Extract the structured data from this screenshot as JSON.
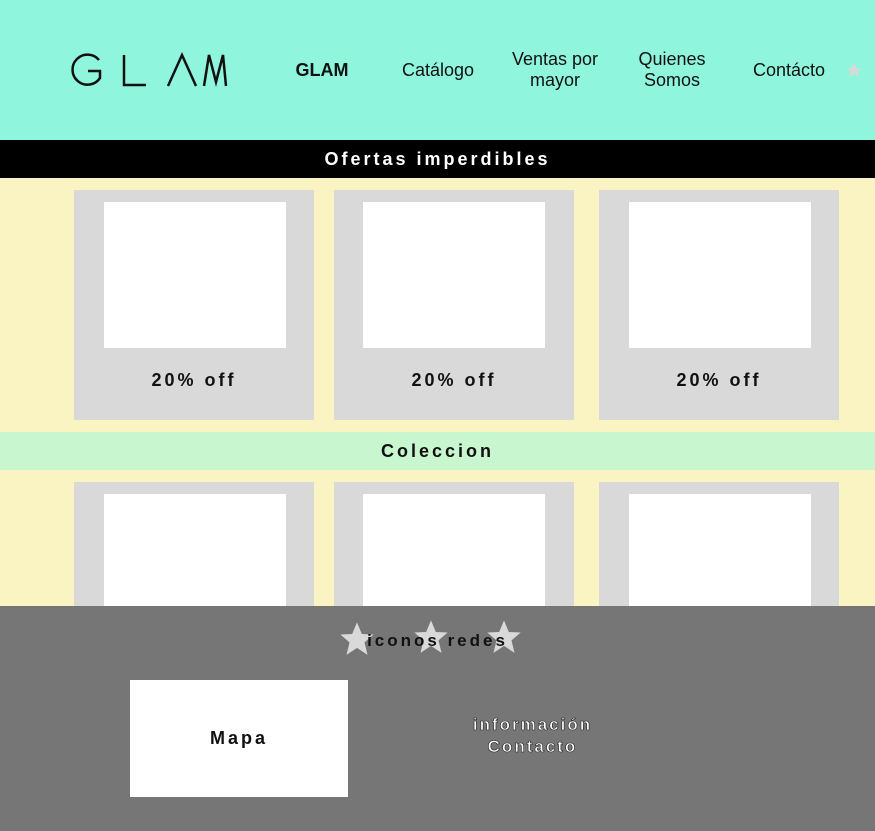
{
  "header": {
    "logo_text": "GLAM",
    "nav": [
      {
        "label": "GLAM"
      },
      {
        "label": "Catálogo"
      },
      {
        "label": "Ventas por mayor"
      },
      {
        "label": "Quienes Somos"
      },
      {
        "label": "Contácto"
      }
    ],
    "star_icon": "star-icon"
  },
  "offers": {
    "title": "Ofertas imperdibles",
    "cards": [
      {
        "label": "20% off"
      },
      {
        "label": "20% off"
      },
      {
        "label": "20% off"
      }
    ]
  },
  "collection": {
    "title": "Coleccion",
    "cards_count_visible": 3
  },
  "footer": {
    "social_label": "iconos redes",
    "map_label": "Mapa",
    "info_label": "información Contacto"
  },
  "colors": {
    "header_bg": "#8ff5dc",
    "offers_bar_bg": "#000000",
    "cream_bg": "#f9f4c1",
    "coleccion_bar_bg": "#c8f7cf",
    "card_bg": "#d9d9d9",
    "footer_bg": "#767676"
  }
}
